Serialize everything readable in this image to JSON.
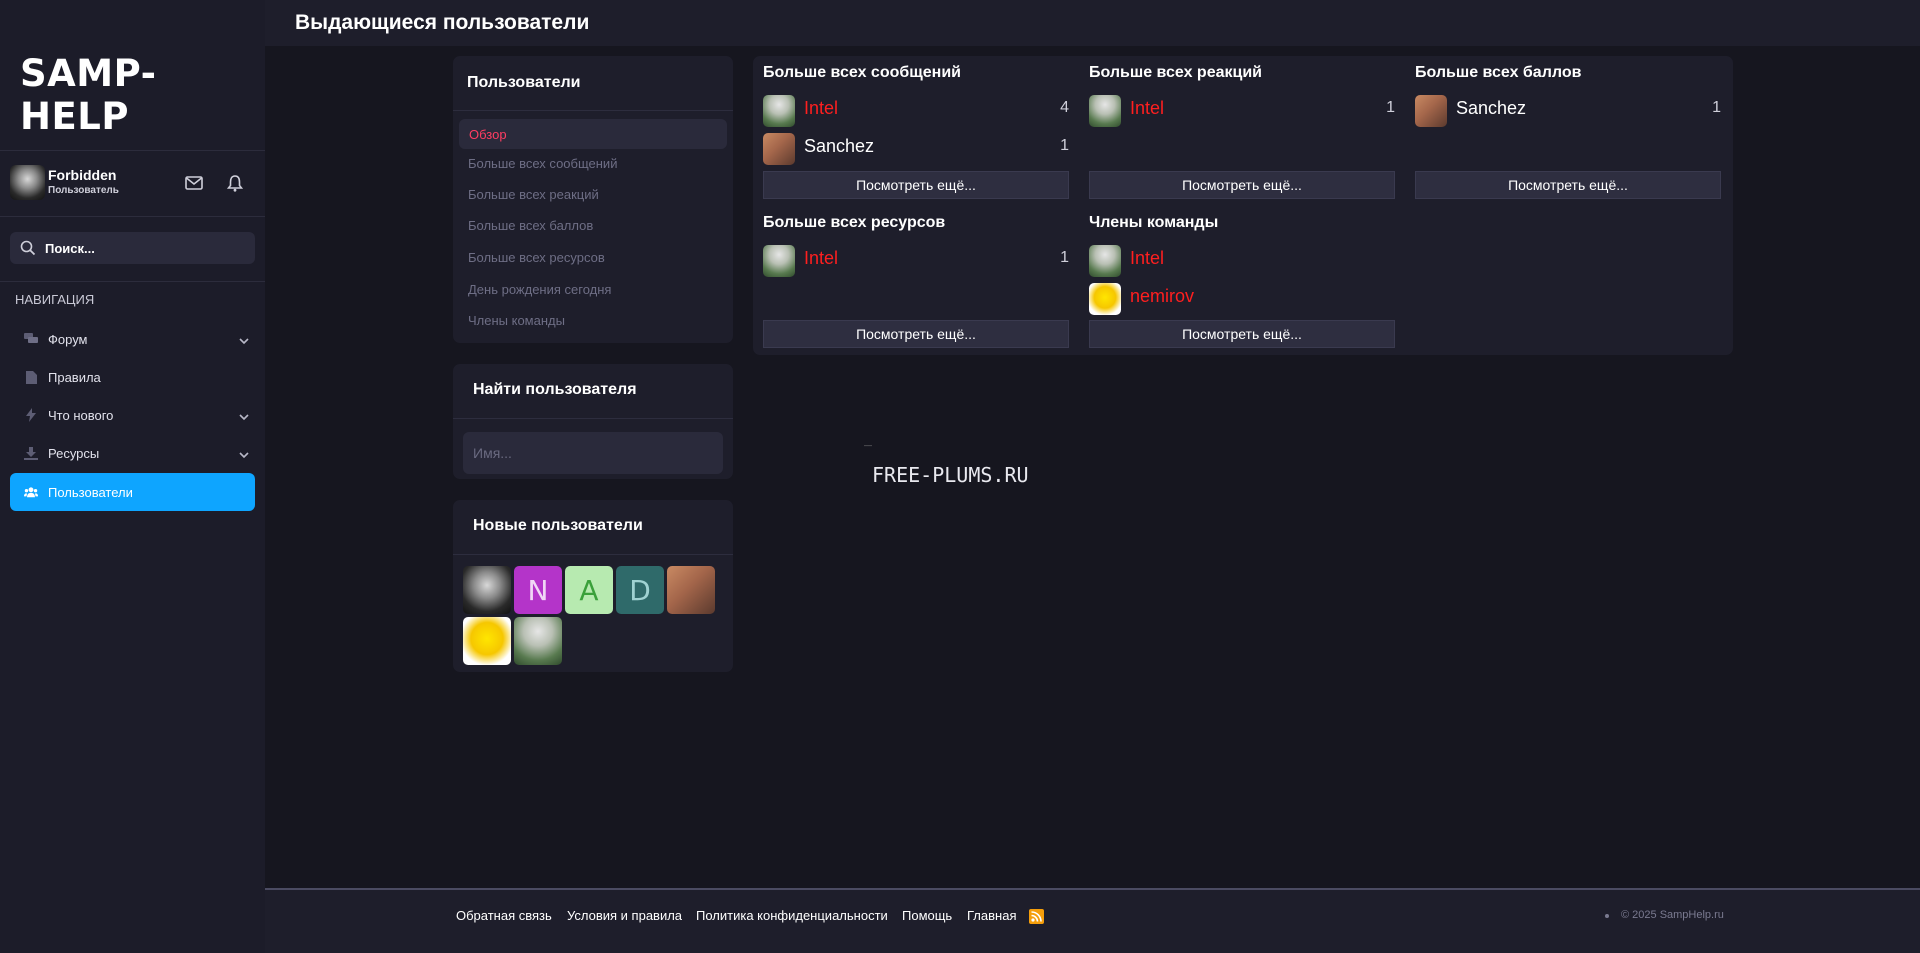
{
  "sidebar": {
    "logo": "SAMP-HELP",
    "user": {
      "name": "Forbidden",
      "title": "Пользователь"
    },
    "search_label": "Поиск...",
    "nav_heading": "НАВИГАЦИЯ",
    "nav_items": [
      {
        "label": "Форум",
        "icon": "comments-icon",
        "expandable": true
      },
      {
        "label": "Правила",
        "icon": "document-icon",
        "expandable": false
      },
      {
        "label": "Что нового",
        "icon": "bolt-icon",
        "expandable": true
      },
      {
        "label": "Ресурсы",
        "icon": "download-icon",
        "expandable": true
      },
      {
        "label": "Пользователи",
        "icon": "users-icon",
        "expandable": false,
        "active": true
      }
    ]
  },
  "header": {
    "title": "Выдающиеся пользователи"
  },
  "members_block": {
    "title": "Пользователи",
    "tabs": [
      "Обзор",
      "Больше всех сообщений",
      "Больше всех реакций",
      "Больше всех баллов",
      "Больше всех ресурсов",
      "День рождения сегодня",
      "Члены команды"
    ],
    "active_tab": "Обзор"
  },
  "find_block": {
    "title": "Найти пользователя",
    "placeholder": "Имя..."
  },
  "new_users_block": {
    "title": "Новые пользователи",
    "avatars": [
      {
        "type": "image",
        "name": "dark-portrait-avatar"
      },
      {
        "type": "letter",
        "letter": "N",
        "bg": "#b434c9",
        "fg": "#f0d6f5"
      },
      {
        "type": "letter",
        "letter": "A",
        "bg": "#b7eab0",
        "fg": "#3aa03a"
      },
      {
        "type": "letter",
        "letter": "D",
        "bg": "#2f6a6a",
        "fg": "#9fd2d2"
      },
      {
        "type": "image",
        "name": "sanchez-avatar"
      },
      {
        "type": "image",
        "name": "nemirov-avatar"
      },
      {
        "type": "image",
        "name": "intel-avatar"
      }
    ]
  },
  "stats": {
    "most_messages": {
      "title": "Больше всех сообщений",
      "rows": [
        {
          "name": "Intel",
          "count": "4",
          "highlight": true
        },
        {
          "name": "Sanchez",
          "count": "1",
          "highlight": false
        }
      ],
      "more": "Посмотреть ещё..."
    },
    "most_reactions": {
      "title": "Больше всех реакций",
      "rows": [
        {
          "name": "Intel",
          "count": "1",
          "highlight": true
        }
      ],
      "more": "Посмотреть ещё..."
    },
    "most_points": {
      "title": "Больше всех баллов",
      "rows": [
        {
          "name": "Sanchez",
          "count": "1",
          "highlight": false
        }
      ],
      "more": "Посмотреть ещё..."
    },
    "most_resources": {
      "title": "Больше всех ресурсов",
      "rows": [
        {
          "name": "Intel",
          "count": "1",
          "highlight": true
        }
      ],
      "more": "Посмотреть ещё..."
    },
    "staff": {
      "title": "Члены команды",
      "rows": [
        {
          "name": "Intel",
          "highlight": true
        },
        {
          "name": "nemirov",
          "highlight": true
        }
      ],
      "more": "Посмотреть ещё..."
    }
  },
  "watermark": "FREE-PLUMS.RU",
  "footer": {
    "links": [
      "Обратная связь",
      "Условия и правила",
      "Политика конфиденциальности",
      "Помощь",
      "Главная"
    ],
    "copyright": "© 2025 SampHelp.ru"
  },
  "colors": {
    "accent": "#0ea5ff",
    "staff_name": "#ff1f1f",
    "active_tab": "#ff3d62",
    "rss": "#f59e0b"
  }
}
